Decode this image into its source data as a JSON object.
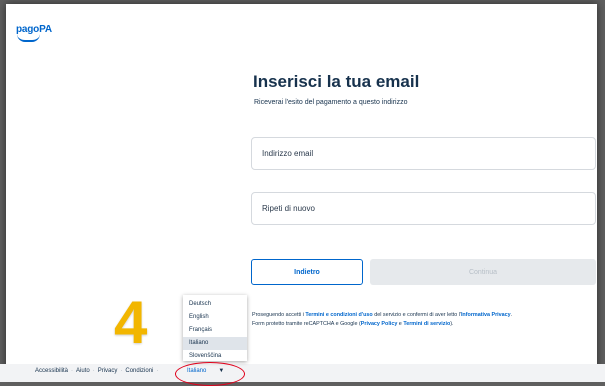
{
  "brand": {
    "logo": "pagoPA"
  },
  "main": {
    "title": "Inserisci la tua email",
    "subtitle": "Riceverai l'esito del pagamento a questo indirizzo"
  },
  "form": {
    "email_placeholder": "Indirizzo email",
    "confirm_placeholder": "Ripeti di nuovo"
  },
  "buttons": {
    "back": "Indietro",
    "continue": "Continua"
  },
  "legal": {
    "p1_a": "Proseguendo accetti i ",
    "terms_link": "Termini e condizioni d'uso",
    "p1_b": " del servizio e confermi di aver letto l'",
    "privacy_link": "Informativa Privacy",
    "p1_c": ".",
    "p2_a": "Form protetto tramite reCAPTCHA e Google (",
    "recaptcha_privacy": "Privacy Policy",
    "p2_b": " e ",
    "recaptcha_terms": "Termini di servizio",
    "p2_c": ")."
  },
  "footer": {
    "links": [
      "Accessibilità",
      "Aiuto",
      "Privacy",
      "Condizioni"
    ],
    "separator": "·",
    "language_selected": "Italiano",
    "caret": "▼"
  },
  "language_dropdown": {
    "options": [
      "Deutsch",
      "English",
      "Français",
      "Italiano",
      "Slovenščina"
    ],
    "selected_index": 3
  },
  "annotation": {
    "step_number": "4",
    "highlight_color": "#e0001b",
    "number_color": "#f2b600"
  },
  "colors": {
    "primary": "#0066cc",
    "text": "#17324d",
    "disabled_bg": "#e6e9ec"
  }
}
